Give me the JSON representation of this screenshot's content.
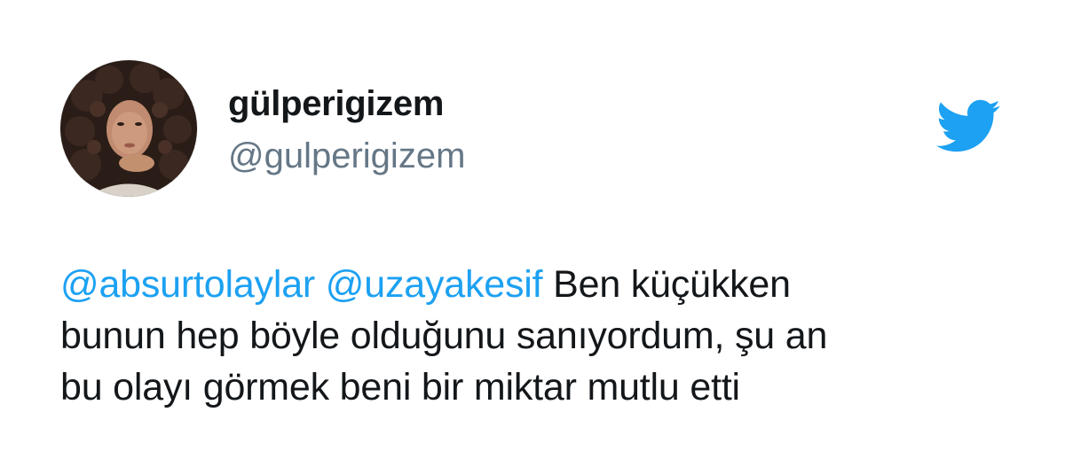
{
  "user": {
    "display_name": "gülperigizem",
    "handle": "@gulperigizem"
  },
  "tweet": {
    "mentions": [
      "@absurtolaylar",
      "@uzayakesif"
    ],
    "line1_rest": "Ben küçükken",
    "line2": "bunun hep böyle olduğunu sanıyordum, şu an",
    "line3": "bu olayı görmek beni bir miktar mutlu etti"
  },
  "icons": {
    "brand": "twitter-bird-icon",
    "avatar": "profile-photo"
  },
  "colors": {
    "text": "#14171a",
    "handle": "#657786",
    "mention": "#1da1f2",
    "brand": "#1da1f2",
    "background": "#ffffff"
  }
}
